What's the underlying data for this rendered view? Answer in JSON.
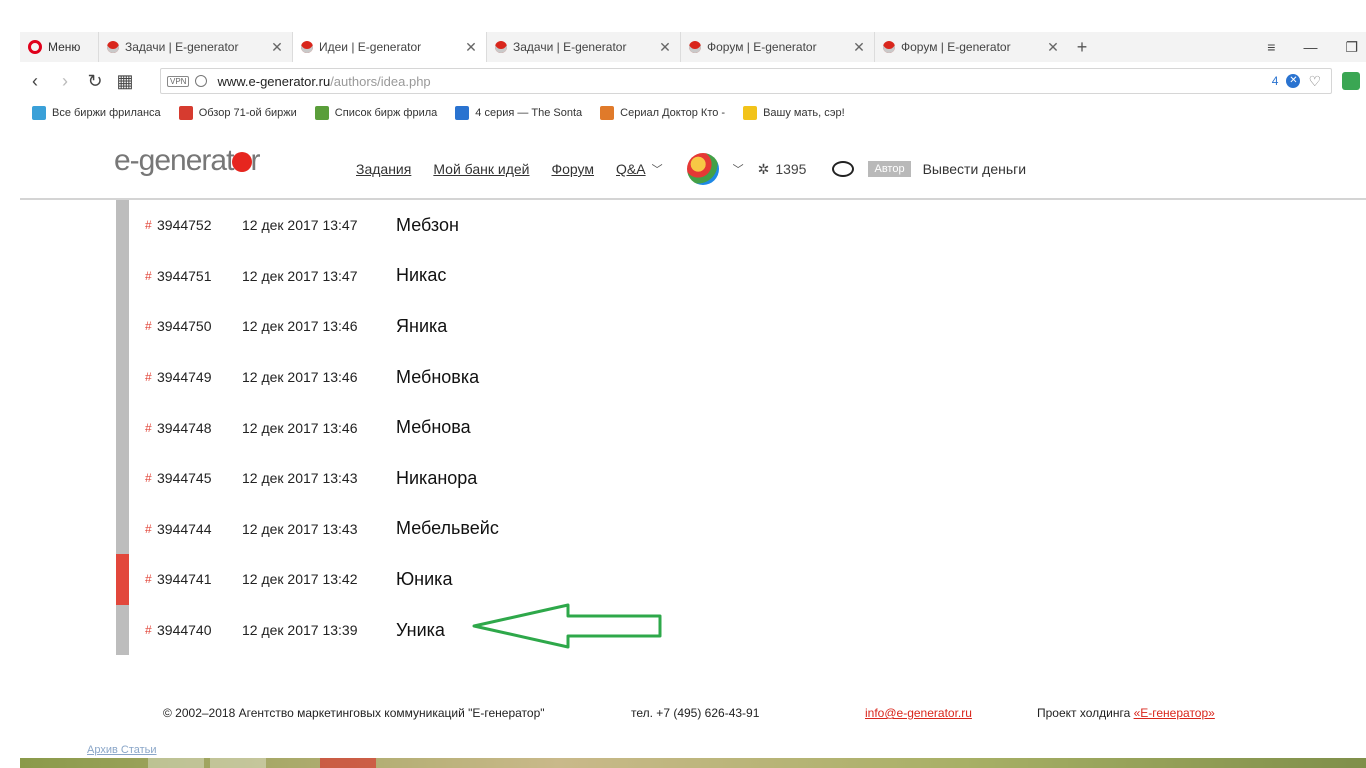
{
  "browser": {
    "menu_label": "Меню",
    "tabs": [
      {
        "title": "Задачи | E-generator",
        "active": false
      },
      {
        "title": "Идеи | E-generator",
        "active": true
      },
      {
        "title": "Задачи | E-generator",
        "active": false
      },
      {
        "title": "Форум | E-generator",
        "active": false
      },
      {
        "title": "Форум | E-generator",
        "active": false
      }
    ],
    "url_host": "www.e-generator.ru",
    "url_path": "/authors/idea.php",
    "vpn_label": "VPN",
    "blocked_count": "4",
    "bookmarks": [
      {
        "label": "Все биржи фриланса",
        "color": "#3aa0d8"
      },
      {
        "label": "Обзор 71-ой биржи",
        "color": "#d63b2f"
      },
      {
        "label": "Список бирж фрила",
        "color": "#5a9e3a"
      },
      {
        "label": "4 серия — The Sonta",
        "color": "#2a73d0"
      },
      {
        "label": "Сериал Доктор Кто -",
        "color": "#e07a2a"
      },
      {
        "label": "Вашу мать, сэр!",
        "color": "#f2c31a"
      }
    ]
  },
  "site": {
    "logo_prefix": "e-generat",
    "logo_suffix": "r",
    "nav": {
      "tasks": "Задания",
      "idea_bank": "Мой банк идей",
      "forum": "Форум",
      "qa": "Q&A"
    },
    "points": "1395",
    "role_badge": "Автор",
    "withdraw": "Вывести деньги"
  },
  "ideas": [
    {
      "id": "3944752",
      "date": "12 дек 2017 13:47",
      "name": "Мебзон",
      "highlight": false
    },
    {
      "id": "3944751",
      "date": "12 дек 2017 13:47",
      "name": "Никас",
      "highlight": false
    },
    {
      "id": "3944750",
      "date": "12 дек 2017 13:46",
      "name": "Яника",
      "highlight": false
    },
    {
      "id": "3944749",
      "date": "12 дек 2017 13:46",
      "name": "Мебновка",
      "highlight": false
    },
    {
      "id": "3944748",
      "date": "12 дек 2017 13:46",
      "name": "Мебнова",
      "highlight": false
    },
    {
      "id": "3944745",
      "date": "12 дек 2017 13:43",
      "name": "Никанора",
      "highlight": false
    },
    {
      "id": "3944744",
      "date": "12 дек 2017 13:43",
      "name": "Мебельвейс",
      "highlight": false
    },
    {
      "id": "3944741",
      "date": "12 дек 2017 13:42",
      "name": "Юника",
      "highlight": true
    },
    {
      "id": "3944740",
      "date": "12 дек 2017 13:39",
      "name": "Уника",
      "highlight": false
    }
  ],
  "footer": {
    "copyright": "© 2002–2018 Агентство маркетинговых коммуникаций \"Е-генератор\"",
    "phone": "тел. +7 (495) 626-43-91",
    "email": "info@e-generator.ru",
    "holding_prefix": "Проект холдинга ",
    "holding_link": "«Е-генератор»",
    "sub_links": "Архив Статьи"
  },
  "colors": {
    "accent_red": "#e2473b",
    "bar_gray": "#bdbdbd",
    "arrow_green": "#2ea84a"
  }
}
